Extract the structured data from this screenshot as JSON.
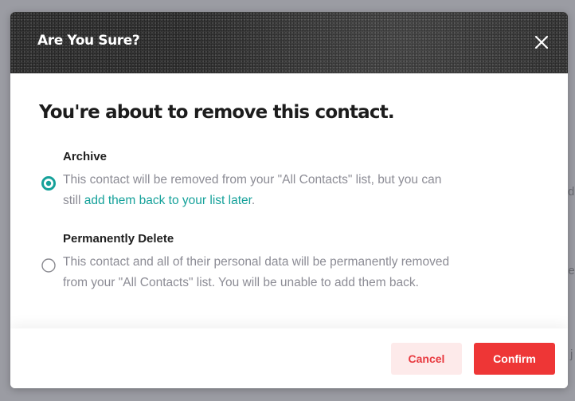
{
  "modal": {
    "title": "Are You Sure?",
    "heading": "You're about to remove this contact."
  },
  "options": [
    {
      "title": "Archive",
      "selected": true,
      "description_line1": "This contact will be removed from your \"All Contacts\" list, but you can",
      "description_prefix": "still ",
      "description_link": "add them back to your list later",
      "description_suffix": "."
    },
    {
      "title": "Permanently Delete",
      "selected": false,
      "description": "This contact and all of their personal data will be permanently removed from your \"All Contacts\" list. You will be unable to add them back."
    }
  ],
  "footer": {
    "cancel_label": "Cancel",
    "confirm_label": "Confirm"
  },
  "background_letters": [
    "d",
    "le",
    "j"
  ],
  "colors": {
    "accent": "#15a19a",
    "danger": "#ee3636",
    "danger_light": "#fdeaea",
    "header_bg": "#262626",
    "muted_text": "#8c8c95"
  },
  "icons": {
    "close": "close-icon",
    "radio_selected": "radio-selected-icon",
    "radio_unselected": "radio-unselected-icon"
  }
}
